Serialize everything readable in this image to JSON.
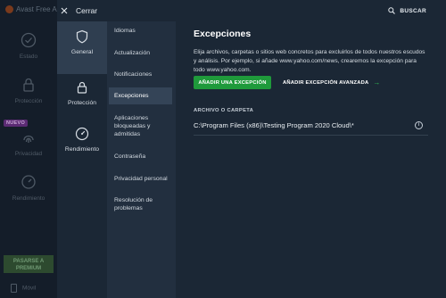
{
  "background_app": {
    "title": "Avast Free A",
    "nav": [
      {
        "label": "Estado"
      },
      {
        "label": "Protección"
      },
      {
        "label": "Privacidad"
      },
      {
        "label": "Rendimiento"
      }
    ],
    "badge": "NUEVO",
    "premium_line1": "PASARSE A",
    "premium_line2": "PREMIUM",
    "mobile": "Móvil"
  },
  "header": {
    "close_label": "Cerrar",
    "search_label": "BUSCAR"
  },
  "categories": [
    {
      "label": "General",
      "icon": "shield-icon",
      "active": true
    },
    {
      "label": "Protección",
      "icon": "lock-icon",
      "active": false
    },
    {
      "label": "Rendimiento",
      "icon": "speedometer-icon",
      "active": false
    }
  ],
  "subnav": [
    {
      "label": "Idiomas"
    },
    {
      "label": "Actualización"
    },
    {
      "label": "Notificaciones"
    },
    {
      "label": "Excepciones",
      "active": true
    },
    {
      "label": "Aplicaciones bloqueadas y admitidas"
    },
    {
      "label": "Contraseña"
    },
    {
      "label": "Privacidad personal"
    },
    {
      "label": "Resolución de problemas"
    }
  ],
  "main": {
    "title": "Excepciones",
    "description": "Elija archivos, carpetas o sitios web concretos para excluirlos de todos nuestros escudos y análisis. Por ejemplo, si añade www.yahoo.com/news, crearemos la excepción para todo www.yahoo.com.",
    "add_button": "AÑADIR UNA EXCEPCIÓN",
    "advanced_button": "AÑADIR EXCEPCIÓN AVANZADA",
    "column_header": "ARCHIVO O CARPETA",
    "rows": [
      {
        "path": "C:\\Program Files (x86)\\Testing Program 2020 Cloud\\*"
      }
    ]
  },
  "colors": {
    "accent_green": "#1f9a3b",
    "panel": "#1b2735",
    "subnav": "#222f3f",
    "active": "#344457"
  }
}
